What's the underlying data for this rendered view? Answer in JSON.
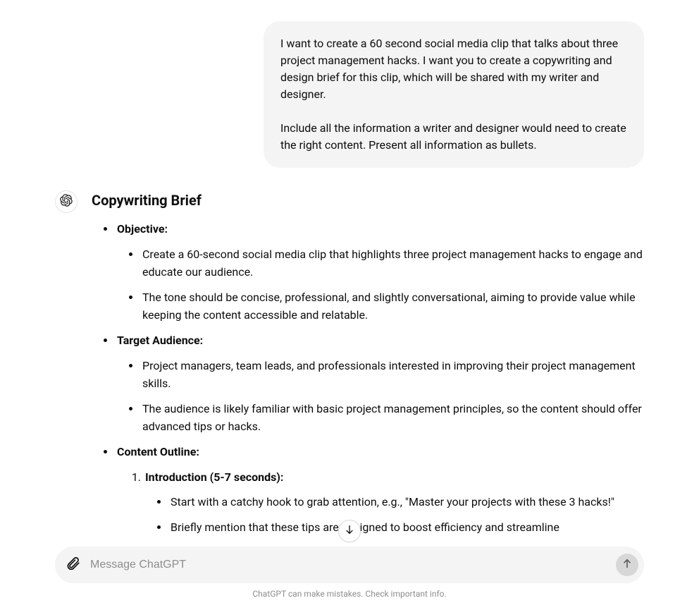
{
  "user_message": {
    "p1": "I want to create a 60 second social media clip that talks about three project management hacks. I want you to create a copywriting and design brief for this clip, which will be shared with my writer and designer.",
    "p2": "Include all the information a writer and designer would need to create the right content. Present all information as bullets."
  },
  "assistant": {
    "heading": "Copywriting Brief",
    "sections": {
      "objective": {
        "label": "Objective:",
        "items": [
          "Create a 60-second social media clip that highlights three project management hacks to engage and educate our audience.",
          "The tone should be concise, professional, and slightly conversational, aiming to provide value while keeping the content accessible and relatable."
        ]
      },
      "target_audience": {
        "label": "Target Audience:",
        "items": [
          "Project managers, team leads, and professionals interested in improving their project management skills.",
          "The audience is likely familiar with basic project management principles, so the content should offer advanced tips or hacks."
        ]
      },
      "content_outline": {
        "label": "Content Outline:",
        "intro": {
          "label": "Introduction (5-7 seconds):",
          "items": [
            "Start with a catchy hook to grab attention, e.g., \"Master your projects with these 3 hacks!\"",
            "Briefly mention that these tips are designed to boost efficiency and streamline"
          ]
        }
      }
    }
  },
  "composer": {
    "placeholder": "Message ChatGPT"
  },
  "disclaimer": "ChatGPT can make mistakes. Check important info."
}
